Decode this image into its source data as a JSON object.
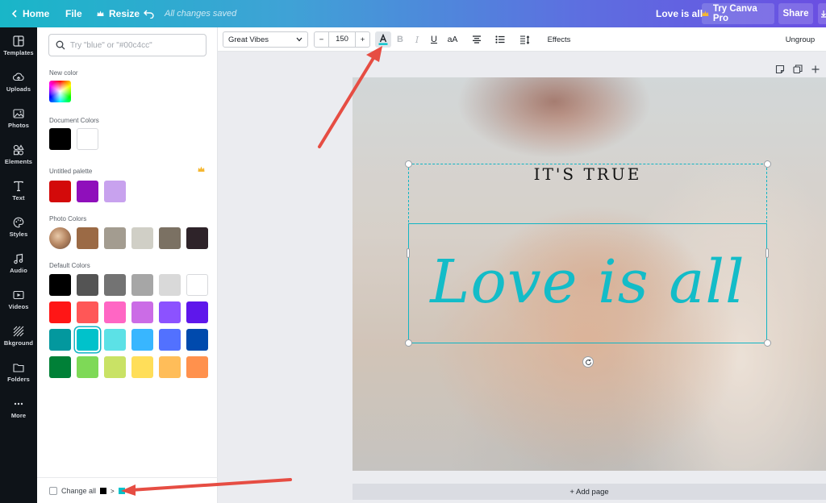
{
  "topbar": {
    "home_label": "Home",
    "file_label": "File",
    "resize_label": "Resize",
    "saved_status": "All changes saved",
    "design_title": "Love is all",
    "try_pro_label": "Try Canva Pro",
    "share_label": "Share"
  },
  "nav": [
    {
      "label": "Templates",
      "icon": "templates-icon"
    },
    {
      "label": "Uploads",
      "icon": "upload-icon"
    },
    {
      "label": "Photos",
      "icon": "photo-icon"
    },
    {
      "label": "Elements",
      "icon": "elements-icon"
    },
    {
      "label": "Text",
      "icon": "text-icon"
    },
    {
      "label": "Styles",
      "icon": "palette-icon"
    },
    {
      "label": "Audio",
      "icon": "music-icon"
    },
    {
      "label": "Videos",
      "icon": "video-icon"
    },
    {
      "label": "Bkground",
      "icon": "background-icon"
    },
    {
      "label": "Folders",
      "icon": "folder-icon"
    },
    {
      "label": "More",
      "icon": "more-icon"
    }
  ],
  "panel": {
    "search_placeholder": "Try \"blue\" or \"#00c4cc\"",
    "new_color_label": "New color",
    "document_colors_label": "Document Colors",
    "document_colors": [
      "#000000",
      "#ffffff"
    ],
    "untitled_palette_label": "Untitled palette",
    "untitled_palette": [
      "#d30a0a",
      "#8f0fbb",
      "#c8a2ee"
    ],
    "photo_colors_label": "Photo Colors",
    "photo_colors": [
      "#9b6a45",
      "#a39c90",
      "#d0cfc6",
      "#7b7163",
      "#2e2329"
    ],
    "default_colors_label": "Default Colors",
    "default_colors": [
      [
        "#000000",
        "#545454",
        "#737373",
        "#a6a6a6",
        "#d9d9d9",
        "#ffffff"
      ],
      [
        "#ff1616",
        "#ff5757",
        "#ff66c4",
        "#cb6ce6",
        "#8c52ff",
        "#5e17eb"
      ],
      [
        "#03989e",
        "#00c2cb",
        "#5ce1e6",
        "#38b6ff",
        "#5271ff",
        "#004aad"
      ],
      [
        "#008037",
        "#7ed957",
        "#c9e265",
        "#ffde59",
        "#ffbd59",
        "#ff914d"
      ]
    ],
    "selected_color": "#00c2cb",
    "change_all_label": "Change all",
    "change_from": "#000000",
    "change_to": "#00c2cb"
  },
  "toolbar": {
    "font_name": "Great Vibes",
    "font_size": "150",
    "minus_label": "−",
    "plus_label": "+",
    "text_color": "#00c2cb",
    "case_label": "aA",
    "effects_label": "Effects",
    "ungroup_label": "Ungroup"
  },
  "canvas": {
    "heading_text": "IT'S TRUE",
    "script_text": "Love is all",
    "script_color": "#13bcc8",
    "add_page_label": "+ Add page"
  },
  "annotations": {
    "arrow_color": "#e64d43"
  }
}
